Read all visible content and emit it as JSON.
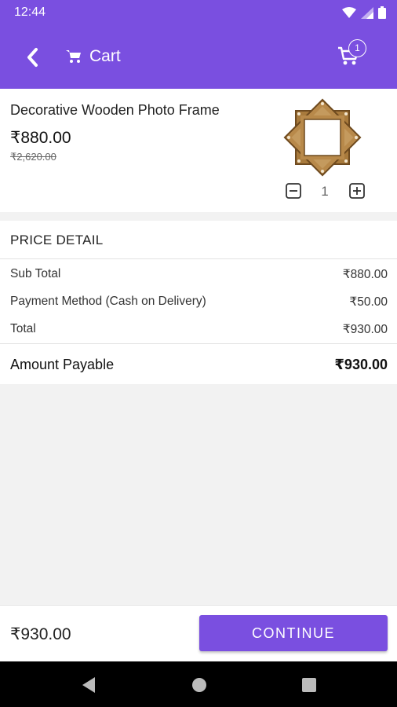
{
  "status_bar": {
    "time": "12:44",
    "icons": [
      "wifi-icon",
      "signal-icon",
      "battery-icon"
    ]
  },
  "app_bar": {
    "title": "Cart",
    "cart_count": "1",
    "color": "#7a4fe0",
    "icons": [
      "back-arrow-icon",
      "cart-icon",
      "cart-icon"
    ]
  },
  "product": {
    "name": "Decorative Wooden Photo Frame",
    "price": "₹880.00",
    "mrp": "₹2,620.00",
    "quantity": "1",
    "image": "wooden-star-frame"
  },
  "price_detail": {
    "title": "PRICE DETAIL",
    "rows": [
      {
        "label": "Sub Total",
        "value": "₹880.00"
      },
      {
        "label": "Payment Method (Cash on Delivery)",
        "value": "₹50.00"
      },
      {
        "label": "Total",
        "value": "₹930.00"
      }
    ],
    "payable": {
      "label": "Amount Payable",
      "value": "₹930.00"
    }
  },
  "footer": {
    "total": "₹930.00",
    "button_label": "CONTINUE"
  },
  "nav_bar": {
    "icons": [
      "back-triangle-icon",
      "home-circle-icon",
      "recents-square-icon"
    ]
  }
}
